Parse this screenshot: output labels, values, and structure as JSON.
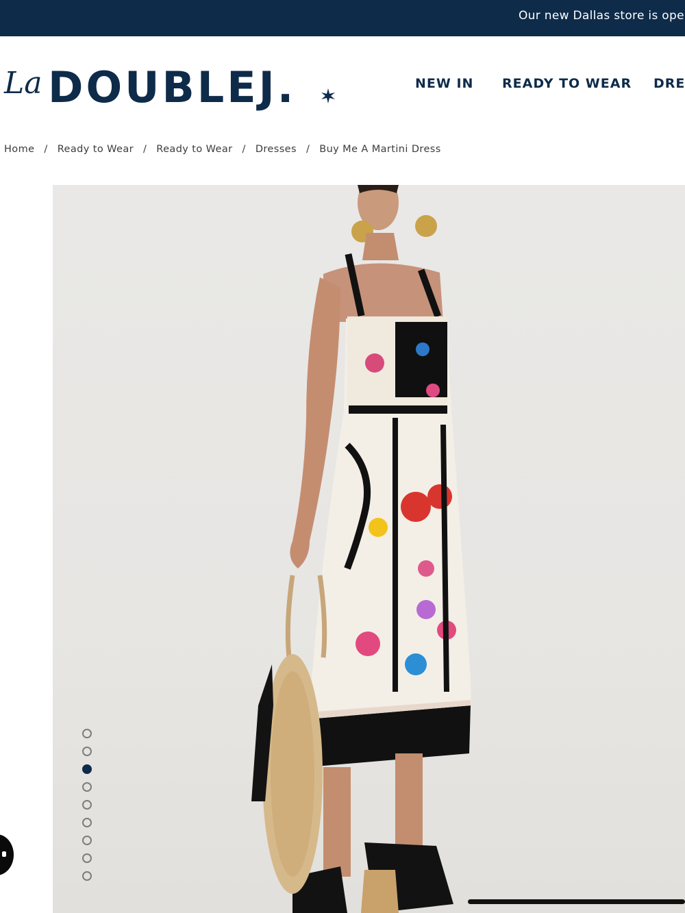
{
  "announcement": {
    "text": "Our new Dallas store is open"
  },
  "header": {
    "logo": {
      "script": "La",
      "word": "DOUBLEJ."
    },
    "nav": [
      {
        "label": "NEW IN"
      },
      {
        "label": "READY TO WEAR"
      },
      {
        "label": "DRESSES"
      }
    ]
  },
  "breadcrumb": {
    "items": [
      {
        "label": "Home"
      },
      {
        "label": "Ready to Wear"
      },
      {
        "label": "Ready to Wear"
      },
      {
        "label": "Dresses"
      },
      {
        "label": "Buy Me A Martini Dress"
      }
    ],
    "separator": "/"
  },
  "gallery": {
    "slide_count": 9,
    "active_slide": 3
  },
  "colors": {
    "brand_navy": "#0e2b4a",
    "announce_bg": "#0e2b4a",
    "image_bg": "#e8e7e4",
    "dot_inactive": "#7d7d7d"
  },
  "icons": {
    "logo_star": "star-icon",
    "chat": "chat-icon"
  }
}
